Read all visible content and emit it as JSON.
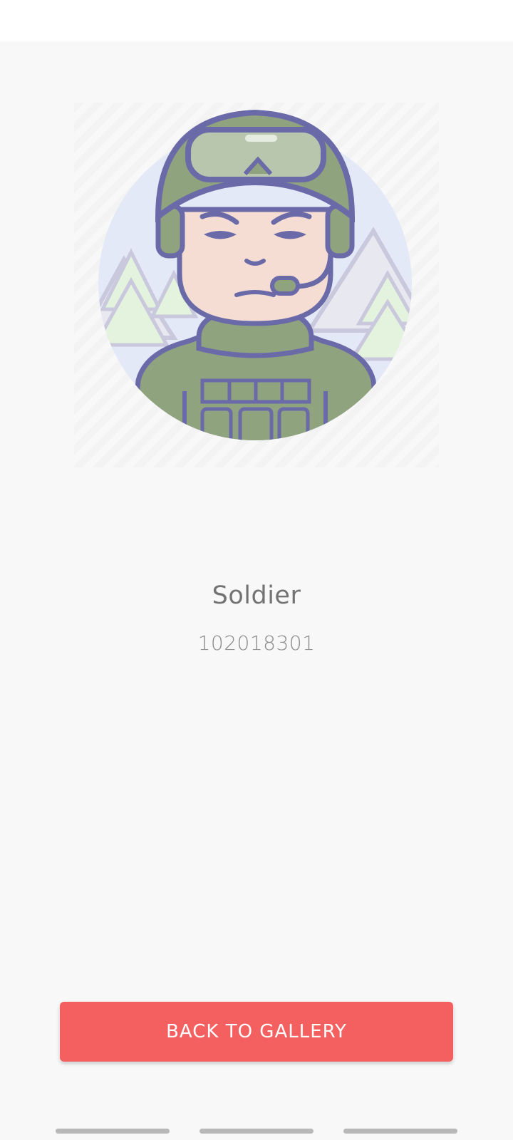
{
  "profile": {
    "name": "Soldier",
    "code": "102018301",
    "avatar_icon": "soldier-avatar-icon"
  },
  "actions": {
    "back_label": "BACK TO GALLERY"
  },
  "colors": {
    "button_bg": "#f45f60",
    "outline": "#6b6aa8",
    "helmet": "#8fa37e",
    "sky": "#dfe7f7"
  }
}
